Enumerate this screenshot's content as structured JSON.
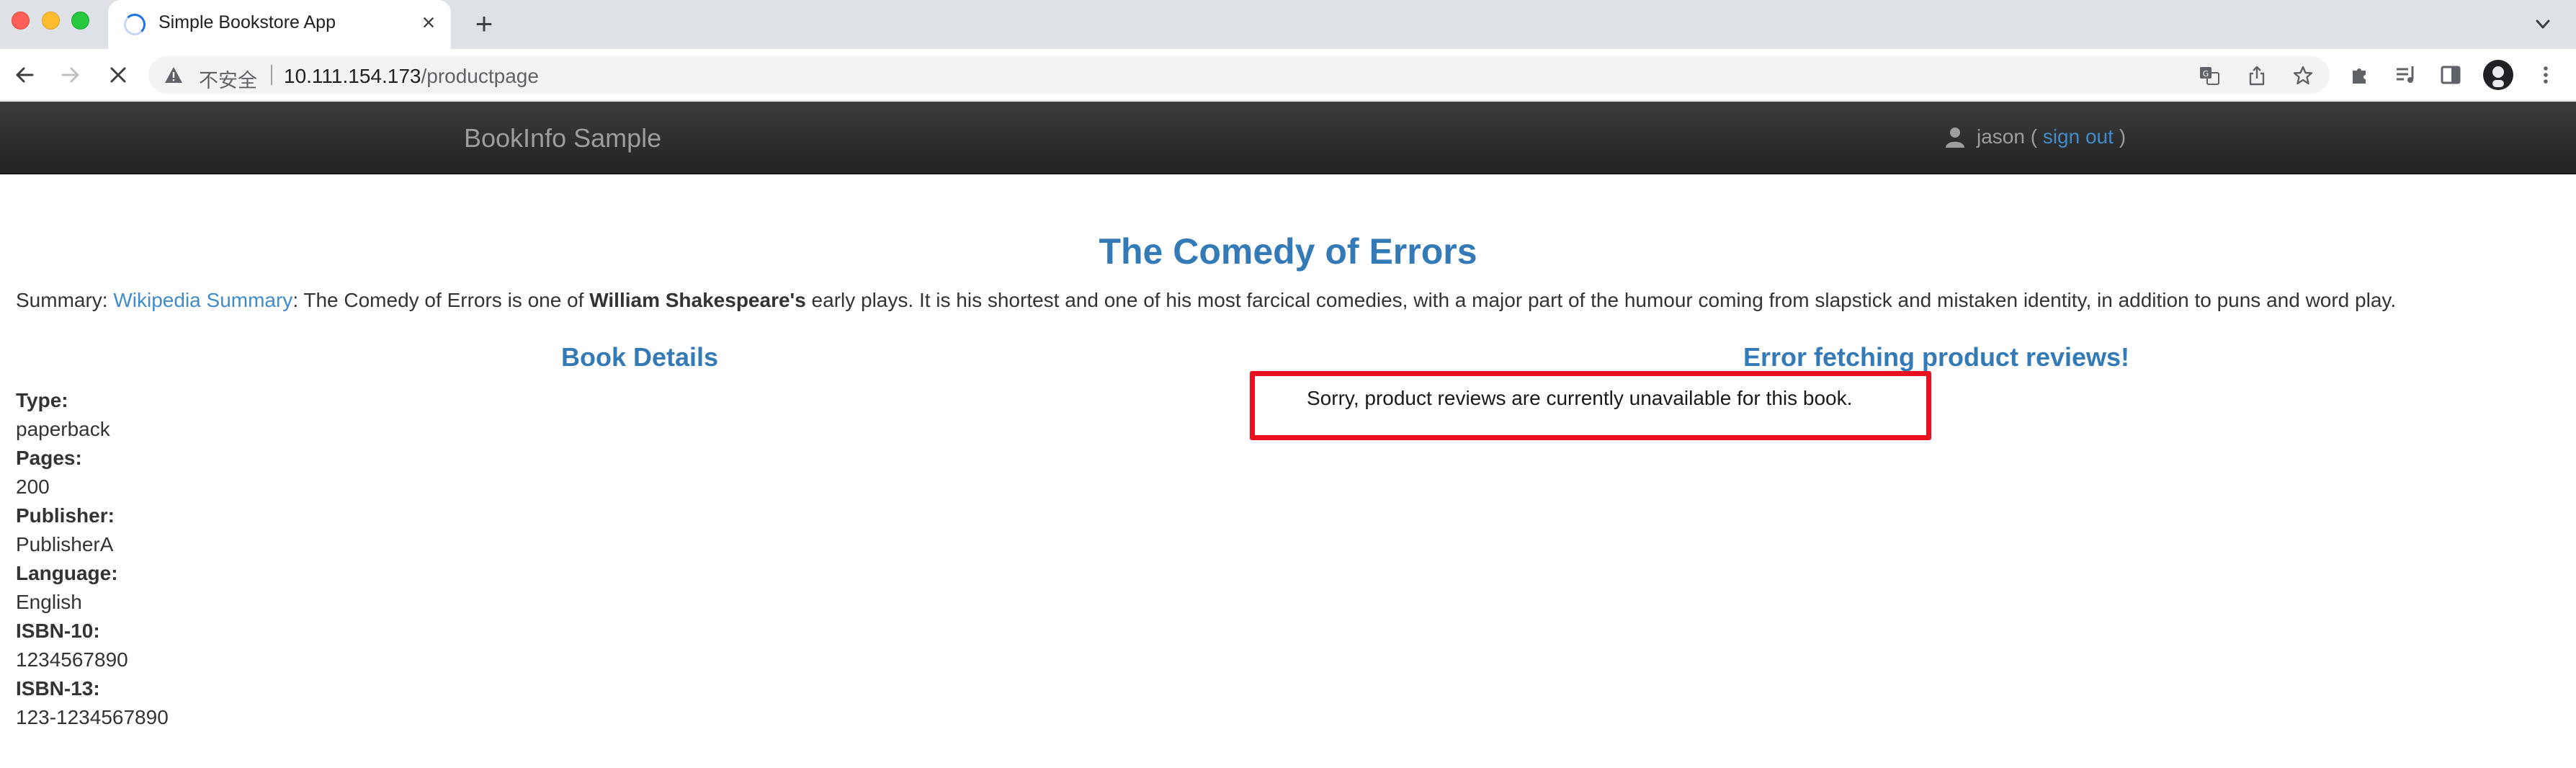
{
  "browser": {
    "tab_title": "Simple Bookstore App",
    "new_tab_glyph": "+",
    "close_glyph": "×",
    "security_label": "不安全",
    "url_host": "10.111.154.173",
    "url_path": "/productpage",
    "icons": [
      "back-icon",
      "forward-icon",
      "stop-icon",
      "warning-icon",
      "translate-icon",
      "share-icon",
      "star-icon",
      "extensions-icon",
      "media-icon",
      "side-panel-icon",
      "profile-avatar",
      "menu-icon",
      "tab-list-icon"
    ]
  },
  "navbar": {
    "brand": "BookInfo Sample",
    "user_name": "jason (",
    "sign_out": "sign out",
    "close_paren": ")"
  },
  "product": {
    "title": "The Comedy of Errors",
    "summary_prefix": "Summary: ",
    "summary_link": "Wikipedia Summary",
    "summary_mid": ": The Comedy of Errors is one of ",
    "summary_author": "William Shakespeare's",
    "summary_rest": " early plays. It is his shortest and one of his most farcical comedies, with a major part of the humour coming from slapstick and mistaken identity, in addition to puns and word play."
  },
  "details": {
    "heading": "Book Details",
    "fields": [
      {
        "label": "Type:",
        "value": "paperback"
      },
      {
        "label": "Pages:",
        "value": "200"
      },
      {
        "label": "Publisher:",
        "value": "PublisherA"
      },
      {
        "label": "Language:",
        "value": "English"
      },
      {
        "label": "ISBN-10:",
        "value": "1234567890"
      },
      {
        "label": "ISBN-13:",
        "value": "123-1234567890"
      }
    ]
  },
  "reviews": {
    "heading": "Error fetching product reviews!",
    "message": "Sorry, product reviews are currently unavailable for this book."
  },
  "colors": {
    "link": "#428bca",
    "heading": "#337ab7",
    "highlight_box": "#e8101e",
    "navbar": "#222222"
  }
}
